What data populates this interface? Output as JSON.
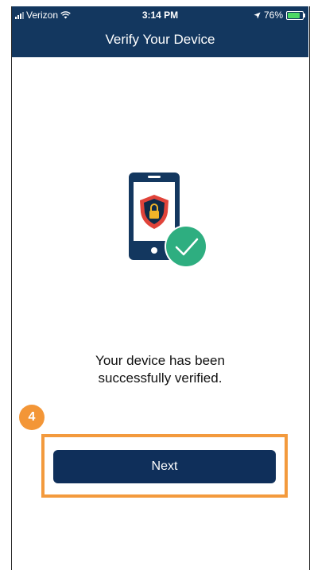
{
  "status_bar": {
    "carrier": "Verizon",
    "time": "3:14 PM",
    "battery": "76%",
    "icons": [
      "signal-icon",
      "wifi-icon",
      "location-arrow-icon",
      "battery-icon"
    ]
  },
  "header": {
    "title": "Verify Your Device"
  },
  "illustration": {
    "icons": [
      "phone-icon",
      "shield-lock-icon",
      "checkmark-icon"
    ]
  },
  "message": {
    "line1": "Your device has been",
    "line2": "successfully verified."
  },
  "annotation": {
    "step": "4",
    "highlight_color": "#f39a3d"
  },
  "actions": {
    "next_label": "Next"
  },
  "colors": {
    "header_bg": "#13375f",
    "button_bg": "#0f2f5a",
    "success": "#2eae80",
    "shield_red": "#e0433a"
  }
}
